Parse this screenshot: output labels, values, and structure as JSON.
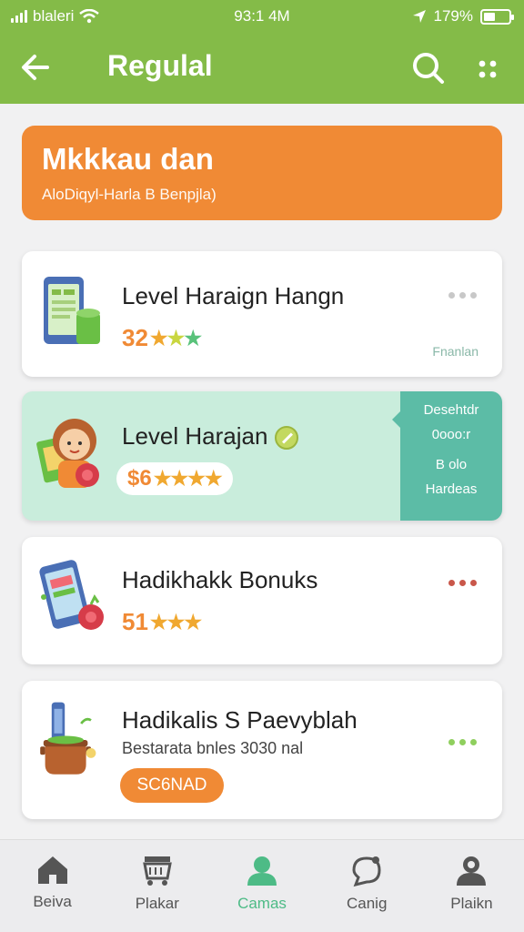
{
  "status": {
    "carrier": "blaleri",
    "time": "93:1 4M",
    "battery": "179%"
  },
  "header": {
    "title": "Regulal"
  },
  "promo": {
    "title": "Mkkkau dan",
    "subtitle": "AloDiqyl-Harla B Benpjla)"
  },
  "cards": [
    {
      "title": "Level Haraign Hangn",
      "rating": "32",
      "stars": "★★★",
      "tag": "Fnanlan"
    },
    {
      "title": "Level Harajan",
      "rating": "$6",
      "stars": "★★★★",
      "side": [
        "Desehtdr",
        "0ooo:r",
        "B olo",
        "Hardeas"
      ]
    },
    {
      "title": "Hadikhakk Bonuks",
      "rating": "51",
      "stars": "★★★"
    },
    {
      "title": "Hadikalis S Paevyblah",
      "desc": "Bestarata bnles 3030 nal",
      "button": "SC6NAD"
    }
  ],
  "nav": [
    {
      "label": "Beiva",
      "icon": "home-icon"
    },
    {
      "label": "Plakar",
      "icon": "cart-icon"
    },
    {
      "label": "Camas",
      "icon": "profile-icon",
      "active": true
    },
    {
      "label": "Canig",
      "icon": "chat-icon"
    },
    {
      "label": "Plaikn",
      "icon": "user-icon"
    }
  ],
  "colors": {
    "primary": "#84bb48",
    "accent": "#f08a35",
    "teal": "#5cbca6",
    "active": "#4dbb86"
  }
}
